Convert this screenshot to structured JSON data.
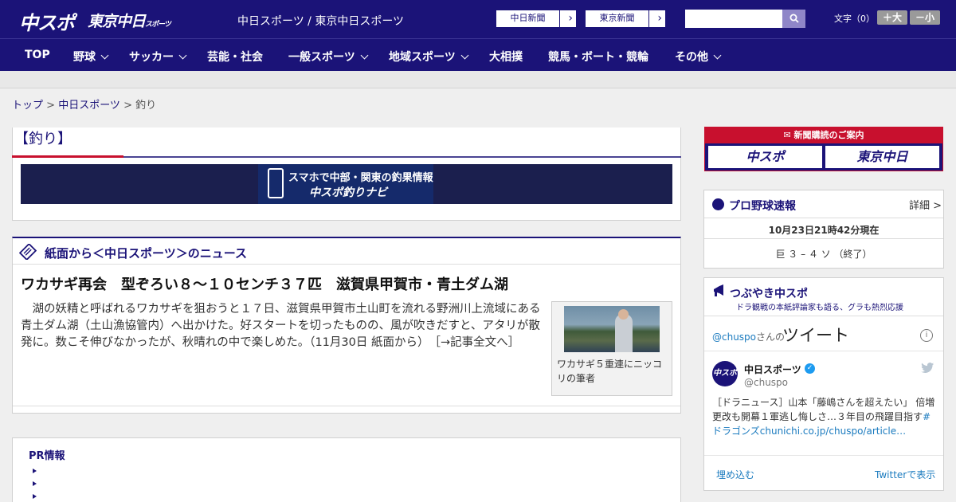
{
  "header": {
    "logo_chuspo": "中スポ",
    "logo_tokyo": "東京中日",
    "logo_tokyo_small": "スポーツ",
    "site_name": "中日スポーツ / 東京中日スポーツ",
    "ext_links": [
      {
        "label": "中日新聞",
        "arrow": "›"
      },
      {
        "label": "東京新聞",
        "arrow": "›"
      }
    ],
    "search": {
      "placeholder": "",
      "icon": "search-icon"
    },
    "font_size_label": "文字（0）",
    "font_bigger": "＋大",
    "font_smaller": "－小"
  },
  "nav": {
    "items": [
      {
        "label": "TOP"
      },
      {
        "label": "野球"
      },
      {
        "label": "サッカー"
      },
      {
        "label": "芸能・社会"
      },
      {
        "label": "一般スポーツ"
      },
      {
        "label": "地域スポーツ"
      },
      {
        "label": "大相撲"
      },
      {
        "label": "競馬・ボート・競輪"
      },
      {
        "label": "その他"
      }
    ]
  },
  "breadcrumb": {
    "top": "トップ",
    "sep": " > ",
    "section": "中日スポーツ",
    "current": "釣り"
  },
  "category": {
    "title": "【釣り】",
    "banner_line1": "スマホで中部・関東の釣果情報",
    "banner_line2": "中スポ釣りナビ"
  },
  "news": {
    "section_title": "紙面から＜中日スポーツ＞のニュース",
    "headline": "ワカサギ再会　型ぞろい８～１０センチ３７匹　滋賀県甲賀市・青土ダム湖",
    "body": "　湖の妖精と呼ばれるワカサギを狙おうと１７日、滋賀県甲賀市土山町を流れる野洲川上流域にある青土ダム湖（土山漁協管内）へ出かけた。好スタートを切ったものの、風が吹きだすと、アタリが散発に。数こそ伸びなかったが、秋晴れの中で楽しめた。（11月30日 紙面から）",
    "read_more": "［→記事全文へ］",
    "photo_caption": "ワカサギ５重連にニッコリの筆者"
  },
  "pr": {
    "title": "PR情報"
  },
  "subscription": {
    "title": "新聞購読のご案内",
    "btn1": "中スポ",
    "btn2": "東京中日"
  },
  "baseball": {
    "title": "プロ野球速報",
    "more": "詳細 >",
    "time": "10月23日21時42分現在",
    "result": "巨 ３ – ４ ソ （終了）"
  },
  "tweets": {
    "title": "つぶやき中スポ",
    "subtitle": "ドラ観戦の本紙評論家も語る、グラも熱烈応援",
    "account": "@chuspo",
    "account_suffix": "さんの",
    "tweets_label": "ツイート",
    "info": "i",
    "user_name": "中日スポーツ",
    "avatar_text": "中スポ",
    "user_handle": "@chuspo",
    "tweet_text": "［ドラニュース］山本「藤嶋さんを超えたい」 倍増更改も開幕１軍逃し悔しさ…３年目の飛躍目指す",
    "tweet_link": "#ドラゴンズchunichi.co.jp/chuspo/article…",
    "embed": "埋め込む",
    "view_on": "Twitterで表示"
  }
}
